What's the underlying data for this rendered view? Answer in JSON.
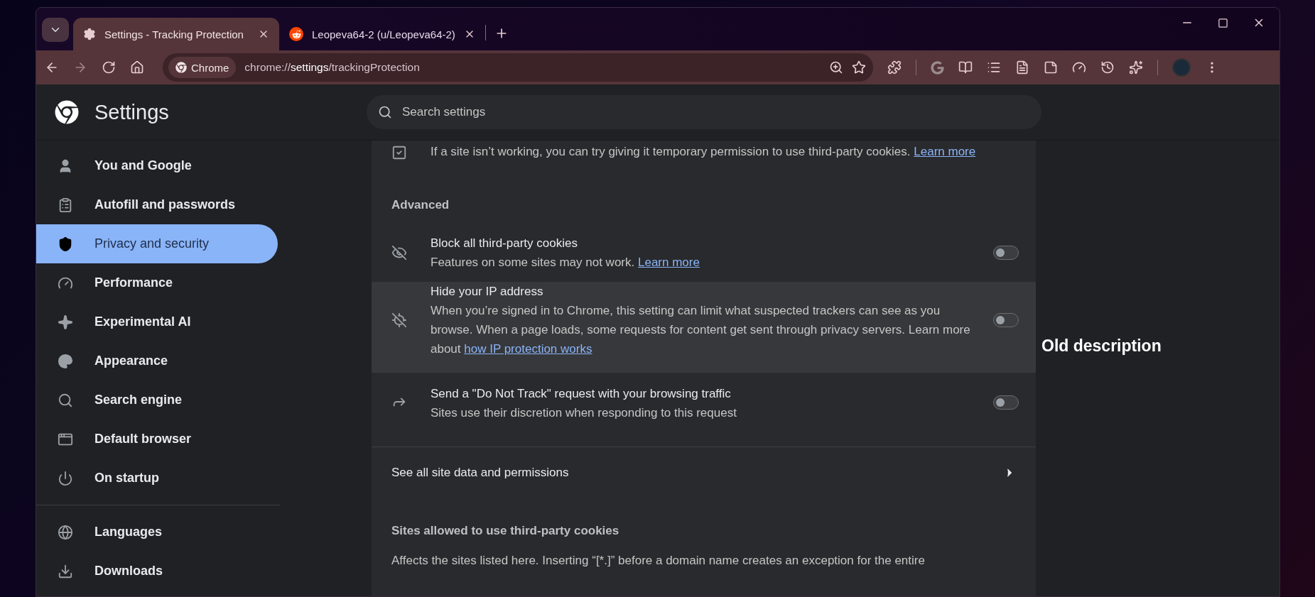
{
  "tabs": [
    {
      "kind": "settings",
      "title": "Settings - Tracking Protection",
      "selected": true
    },
    {
      "kind": "reddit",
      "title": "Leopeva64-2 (u/Leopeva64-2)",
      "selected": false
    }
  ],
  "address_bar": {
    "chip": "Chrome",
    "url": "chrome://**settings**/trackingProtection"
  },
  "settings_header": {
    "title": "Settings",
    "search_placeholder": "Search settings"
  },
  "sidebar": {
    "groups": [
      [
        {
          "label": "You and Google",
          "selected": false
        },
        {
          "label": "Autofill and passwords",
          "selected": false
        },
        {
          "label": "Privacy and security",
          "selected": true
        },
        {
          "label": "Performance",
          "selected": false
        },
        {
          "label": "Experimental AI",
          "selected": false
        },
        {
          "label": "Appearance",
          "selected": false
        },
        {
          "label": "Search engine",
          "selected": false
        },
        {
          "label": "Default browser",
          "selected": false
        },
        {
          "label": "On startup",
          "selected": false
        }
      ],
      [
        {
          "label": "Languages",
          "selected": false
        },
        {
          "label": "Downloads",
          "selected": false
        }
      ]
    ]
  },
  "content": {
    "intro": {
      "text": "If a site isn’t working, you can try giving it temporary permission to use third-party cookies.",
      "link": "Learn more"
    },
    "section_title": "Advanced",
    "rows": [
      {
        "title": "Block all third-party cookies",
        "description": "Features on some sites may not work.",
        "link": "Learn more",
        "on": false,
        "highlighted": false
      },
      {
        "title": "Hide your IP address",
        "description": "When you’re signed in to Chrome, this setting can limit what suspected trackers can see as you browse. When a page loads, some requests for content get sent through privacy servers. Learn more about",
        "link": "how IP protection works",
        "on": false,
        "highlighted": true
      },
      {
        "title": "Send a \"Do Not Track\" request with your browsing traffic",
        "description": "Sites use their discretion when responding to this request",
        "on": false,
        "highlighted": false
      }
    ],
    "see_all": "See all site data and permissions",
    "allowed_heading": "Sites allowed to use third-party cookies",
    "allowed_text": "Affects the sites listed here. Inserting “[*.]” before a domain name creates an exception for the entire"
  },
  "annotation": "Old description"
}
